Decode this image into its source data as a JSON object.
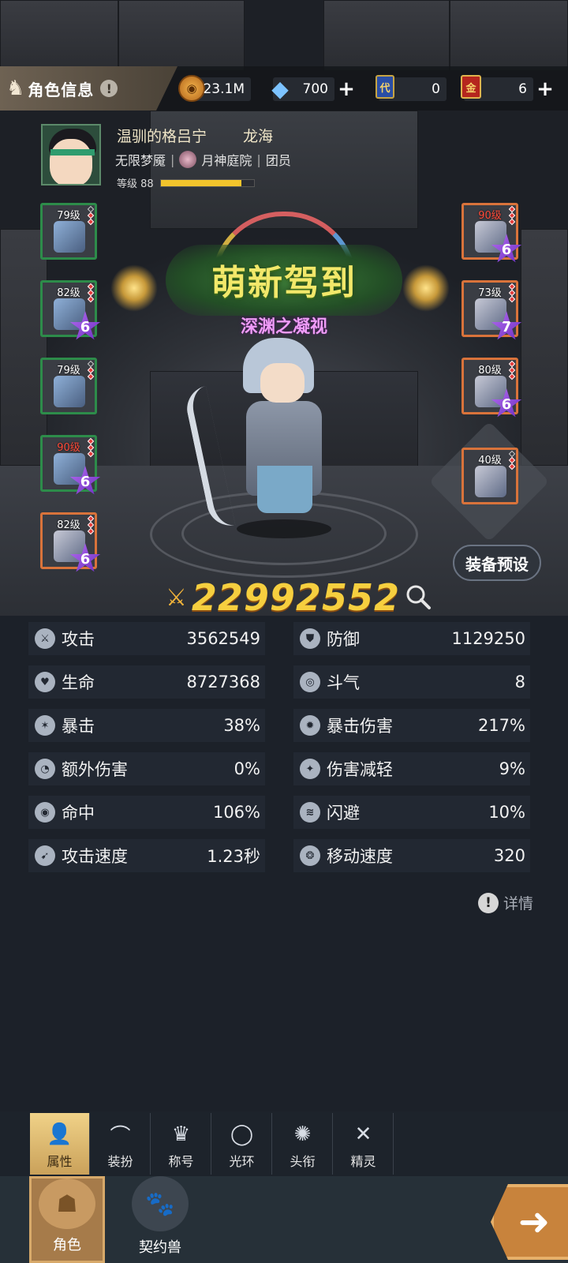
{
  "header": {
    "title": "角色信息",
    "info_icon": "!"
  },
  "resources": [
    {
      "name": "gold-coin-icon",
      "value": "23.1M",
      "has_plus": false
    },
    {
      "name": "crystal-gem-icon",
      "value": "700",
      "has_plus": true
    },
    {
      "name": "blue-card-icon",
      "value": "0",
      "has_plus": false
    },
    {
      "name": "gold-card-icon",
      "value": "6",
      "has_plus": true
    }
  ],
  "resource_glyphs": {
    "coin": "◉",
    "gem": "◆",
    "blue_card": "代",
    "red_card": "金"
  },
  "player": {
    "name": "温驯的格吕宁",
    "server": "龙海",
    "class": "无限梦魇",
    "guild": "月神庭院",
    "role": "团员",
    "level_text": "等级 88",
    "level_progress": 0.87
  },
  "equipment_left": [
    {
      "level": "79级",
      "level_color": "white",
      "border": "green",
      "star": null
    },
    {
      "level": "82级",
      "level_color": "white",
      "border": "green",
      "star": "6"
    },
    {
      "level": "79级",
      "level_color": "white",
      "border": "green",
      "star": null
    },
    {
      "level": "90级",
      "level_color": "red",
      "border": "green",
      "star": "6"
    },
    {
      "level": "82级",
      "level_color": "white",
      "border": "orange",
      "star": "6"
    }
  ],
  "equipment_right": [
    {
      "level": "90级",
      "level_color": "red",
      "border": "orange",
      "star": "6"
    },
    {
      "level": "73级",
      "level_color": "white",
      "border": "orange",
      "star": "7"
    },
    {
      "level": "80级",
      "level_color": "white",
      "border": "orange",
      "star": "6"
    },
    {
      "level": "40级",
      "level_color": "white",
      "border": "orange",
      "star": null
    }
  ],
  "title_banner": {
    "main": "萌新驾到",
    "subtitle": "深渊之凝视"
  },
  "equipment_preset_label": "装备预设",
  "combat_power": "22992552",
  "combat_power_icon": "⚔",
  "stats": [
    {
      "label": "攻击",
      "value": "3562549",
      "icon": "sword-icon"
    },
    {
      "label": "防御",
      "value": "1129250",
      "icon": "armor-icon"
    },
    {
      "label": "生命",
      "value": "8727368",
      "icon": "heart-icon"
    },
    {
      "label": "斗气",
      "value": "8",
      "icon": "swirl-icon"
    },
    {
      "label": "暴击",
      "value": "38%",
      "icon": "crit-icon"
    },
    {
      "label": "暴击伤害",
      "value": "217%",
      "icon": "burst-icon"
    },
    {
      "label": "额外伤害",
      "value": "0%",
      "icon": "extra-damage-icon"
    },
    {
      "label": "伤害减轻",
      "value": "9%",
      "icon": "damage-reduction-icon"
    },
    {
      "label": "命中",
      "value": "106%",
      "icon": "target-icon"
    },
    {
      "label": "闪避",
      "value": "10%",
      "icon": "dodge-icon"
    },
    {
      "label": "攻击速度",
      "value": "1.23秒",
      "icon": "attack-speed-icon"
    },
    {
      "label": "移动速度",
      "value": "320",
      "icon": "move-speed-icon"
    }
  ],
  "details_label": "详情",
  "tabs": [
    {
      "label": "属性",
      "icon": "person-icon",
      "glyph": "👤",
      "active": true
    },
    {
      "label": "装扮",
      "icon": "hanger-icon",
      "glyph": "⌒",
      "active": false
    },
    {
      "label": "称号",
      "icon": "crown-icon",
      "glyph": "♛",
      "active": false
    },
    {
      "label": "光环",
      "icon": "halo-icon",
      "glyph": "◯",
      "active": false
    },
    {
      "label": "头衔",
      "icon": "emblem-icon",
      "glyph": "✺",
      "active": false
    },
    {
      "label": "精灵",
      "icon": "sprite-icon",
      "glyph": "✕",
      "active": false
    }
  ],
  "nav": [
    {
      "label": "角色",
      "icon": "character-icon",
      "active": true
    },
    {
      "label": "契约兽",
      "icon": "paw-icon",
      "active": false
    }
  ],
  "nav_glyphs": {
    "character": "☗",
    "paw": "🐾"
  },
  "exit_glyph": "➜",
  "colors": {
    "power": "#f6cf3f",
    "accent_gold": "#f2c42c",
    "slot_green": "#2d8c4a",
    "slot_orange": "#d9733b",
    "star_purple": "#8a44d6",
    "subtitle_pink": "#ef9cf7"
  }
}
